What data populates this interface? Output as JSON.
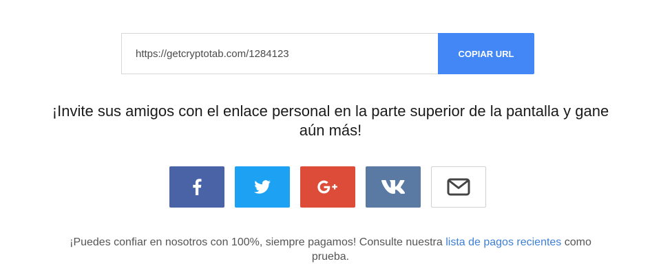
{
  "referral": {
    "url_value": "https://getcryptotab.com/1284123",
    "copy_label": "COPIAR URL"
  },
  "headline": {
    "line1": "¡Invite sus amigos con el enlace personal en la parte superior de la pantalla y gane",
    "line2": "aún más!"
  },
  "share": {
    "buttons": [
      {
        "name": "facebook",
        "color": "#4a63a6",
        "icon": "facebook-icon"
      },
      {
        "name": "twitter",
        "color": "#1da1f2",
        "icon": "twitter-icon"
      },
      {
        "name": "google-plus",
        "color": "#dd4b39",
        "icon": "google-plus-icon"
      },
      {
        "name": "vk",
        "color": "#5a7aa3",
        "icon": "vk-icon"
      },
      {
        "name": "email",
        "color": "#ffffff",
        "icon": "envelope-icon"
      }
    ]
  },
  "trust": {
    "text_before": "¡Puedes confiar en nosotros con 100%, siempre pagamos! Consulte nuestra ",
    "link_text": "lista de pagos recientes",
    "text_after": " como",
    "line2": "prueba."
  }
}
